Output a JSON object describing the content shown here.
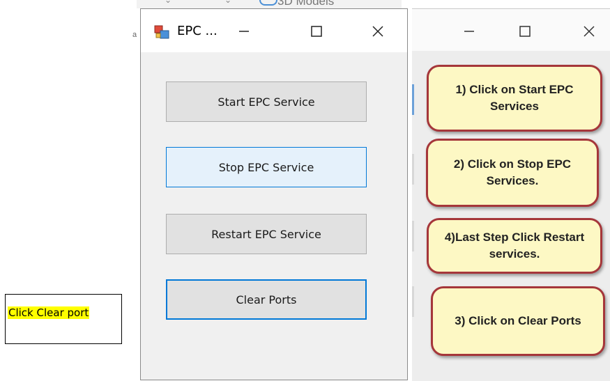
{
  "annotation": {
    "label": "Click Clear port"
  },
  "background_window": {
    "tab_text": "3D Models",
    "edge_glyph": "a"
  },
  "dialog": {
    "title": "EPC ...",
    "icons": {
      "app": "app-window-icon",
      "minimize": "minimize-icon",
      "maximize": "maximize-icon",
      "close": "close-icon"
    },
    "buttons": {
      "start": "Start EPC Service",
      "stop": "Stop EPC Service",
      "restart": "Restart EPC Service",
      "clear": "Clear Ports"
    }
  },
  "guide": {
    "icons": {
      "minimize": "minimize-icon",
      "maximize": "maximize-icon",
      "close": "close-icon"
    },
    "steps": [
      {
        "text": "1) Click on Start EPC Services"
      },
      {
        "text": "2) Click on Stop EPC Services."
      },
      {
        "text": "4)Last Step Click Restart services."
      },
      {
        "text": "3) Click on Clear Ports"
      }
    ]
  },
  "colors": {
    "callout_fill": "#fdf8c4",
    "callout_border": "#a5363a",
    "focus_blue": "#0078d7",
    "highlight": "#ffff00"
  }
}
